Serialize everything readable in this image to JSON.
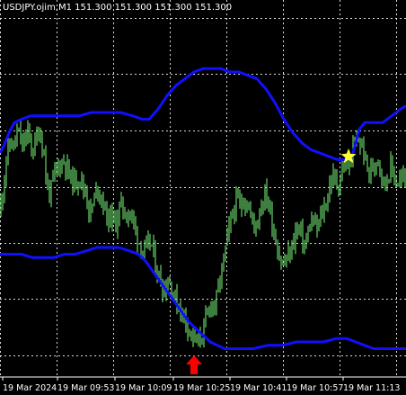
{
  "window": {
    "header": "USDJPY.ojim,M1  151.300 151.300 151.300 151.300"
  },
  "colors": {
    "background": "#000000",
    "grid": "#ffffff",
    "candles": "#7CFC7C",
    "bands": "#1010ff",
    "buy_arrow": "#ff0000",
    "star": "#ffff33",
    "text": "#ffffff"
  },
  "icons": {
    "buy_signal": "red-up-arrow-icon",
    "sell_signal": "yellow-star-icon"
  },
  "chart_data": {
    "type": "candlestick",
    "symbol": "USDJPY.ojim",
    "timeframe": "M1",
    "x_tick_labels": [
      "19 Mar 2024",
      "19 Mar 09:53",
      "19 Mar 10:09",
      "19 Mar 10:25",
      "19 Mar 10:41",
      "19 Mar 10:57",
      "19 Mar 11:13"
    ],
    "grid": true,
    "ylim": [
      0,
      100
    ],
    "upper_band": [
      [
        0,
        60
      ],
      [
        4,
        62
      ],
      [
        10,
        66
      ],
      [
        16,
        69
      ],
      [
        24,
        70
      ],
      [
        34,
        71
      ],
      [
        48,
        71
      ],
      [
        60,
        71
      ],
      [
        74,
        71
      ],
      [
        88,
        71
      ],
      [
        102,
        72
      ],
      [
        118,
        72
      ],
      [
        134,
        72
      ],
      [
        148,
        71
      ],
      [
        158,
        70
      ],
      [
        166,
        70
      ],
      [
        176,
        73
      ],
      [
        186,
        77
      ],
      [
        196,
        80
      ],
      [
        206,
        82
      ],
      [
        216,
        84
      ],
      [
        226,
        85
      ],
      [
        236,
        85
      ],
      [
        246,
        85
      ],
      [
        256,
        84
      ],
      [
        266,
        84
      ],
      [
        276,
        83
      ],
      [
        286,
        82
      ],
      [
        296,
        79
      ],
      [
        306,
        75
      ],
      [
        316,
        70
      ],
      [
        326,
        66
      ],
      [
        336,
        63
      ],
      [
        346,
        61
      ],
      [
        356,
        60
      ],
      [
        366,
        59
      ],
      [
        376,
        58
      ],
      [
        386,
        58
      ],
      [
        392,
        59
      ],
      [
        400,
        67
      ],
      [
        406,
        69
      ],
      [
        416,
        69
      ],
      [
        426,
        69
      ],
      [
        436,
        71
      ],
      [
        446,
        73
      ],
      [
        452,
        74
      ]
    ],
    "lower_band": [
      [
        0,
        30
      ],
      [
        12,
        30
      ],
      [
        24,
        30
      ],
      [
        36,
        29
      ],
      [
        48,
        29
      ],
      [
        60,
        29
      ],
      [
        72,
        30
      ],
      [
        84,
        30
      ],
      [
        96,
        31
      ],
      [
        108,
        32
      ],
      [
        120,
        32
      ],
      [
        132,
        32
      ],
      [
        144,
        31
      ],
      [
        154,
        30
      ],
      [
        162,
        28
      ],
      [
        170,
        25
      ],
      [
        178,
        22
      ],
      [
        186,
        19
      ],
      [
        194,
        16
      ],
      [
        202,
        13
      ],
      [
        210,
        10
      ],
      [
        218,
        8
      ],
      [
        226,
        6
      ],
      [
        234,
        4
      ],
      [
        242,
        3
      ],
      [
        250,
        2
      ],
      [
        258,
        2
      ],
      [
        270,
        2
      ],
      [
        282,
        2
      ],
      [
        298,
        3
      ],
      [
        314,
        3
      ],
      [
        330,
        4
      ],
      [
        346,
        4
      ],
      [
        360,
        4
      ],
      [
        374,
        5
      ],
      [
        386,
        5
      ],
      [
        396,
        4
      ],
      [
        406,
        3
      ],
      [
        416,
        2
      ],
      [
        426,
        2
      ],
      [
        438,
        2
      ],
      [
        452,
        2
      ]
    ],
    "price_path": [
      [
        0,
        42
      ],
      [
        4,
        52
      ],
      [
        8,
        60
      ],
      [
        12,
        63
      ],
      [
        16,
        62
      ],
      [
        20,
        67
      ],
      [
        24,
        62
      ],
      [
        28,
        64
      ],
      [
        32,
        66
      ],
      [
        36,
        60
      ],
      [
        40,
        64
      ],
      [
        44,
        67
      ],
      [
        48,
        62
      ],
      [
        52,
        50
      ],
      [
        56,
        48
      ],
      [
        60,
        53
      ],
      [
        64,
        56
      ],
      [
        68,
        57
      ],
      [
        72,
        58
      ],
      [
        76,
        54
      ],
      [
        80,
        52
      ],
      [
        84,
        51
      ],
      [
        88,
        54
      ],
      [
        92,
        50
      ],
      [
        96,
        48
      ],
      [
        100,
        42
      ],
      [
        104,
        45
      ],
      [
        108,
        50
      ],
      [
        112,
        48
      ],
      [
        116,
        44
      ],
      [
        120,
        40
      ],
      [
        124,
        42
      ],
      [
        128,
        38
      ],
      [
        132,
        43
      ],
      [
        136,
        45
      ],
      [
        140,
        41
      ],
      [
        144,
        43
      ],
      [
        148,
        40
      ],
      [
        152,
        36
      ],
      [
        156,
        33
      ],
      [
        160,
        30
      ],
      [
        164,
        32
      ],
      [
        168,
        34
      ],
      [
        172,
        28
      ],
      [
        176,
        24
      ],
      [
        180,
        21
      ],
      [
        184,
        20
      ],
      [
        188,
        23
      ],
      [
        192,
        19
      ],
      [
        196,
        16
      ],
      [
        200,
        14
      ],
      [
        204,
        12
      ],
      [
        208,
        10
      ],
      [
        212,
        7
      ],
      [
        216,
        5
      ],
      [
        220,
        3
      ],
      [
        224,
        6
      ],
      [
        228,
        9
      ],
      [
        232,
        13
      ],
      [
        236,
        16
      ],
      [
        240,
        15
      ],
      [
        244,
        21
      ],
      [
        248,
        27
      ],
      [
        252,
        33
      ],
      [
        256,
        39
      ],
      [
        260,
        43
      ],
      [
        264,
        46
      ],
      [
        268,
        44
      ],
      [
        272,
        47
      ],
      [
        276,
        44
      ],
      [
        280,
        41
      ],
      [
        284,
        38
      ],
      [
        288,
        42
      ],
      [
        292,
        46
      ],
      [
        296,
        48
      ],
      [
        300,
        44
      ],
      [
        304,
        38
      ],
      [
        308,
        33
      ],
      [
        312,
        28
      ],
      [
        316,
        27
      ],
      [
        320,
        29
      ],
      [
        324,
        31
      ],
      [
        328,
        36
      ],
      [
        332,
        38
      ],
      [
        336,
        35
      ],
      [
        340,
        32
      ],
      [
        344,
        38
      ],
      [
        348,
        40
      ],
      [
        352,
        37
      ],
      [
        356,
        40
      ],
      [
        360,
        43
      ],
      [
        364,
        46
      ],
      [
        368,
        52
      ],
      [
        372,
        53
      ],
      [
        376,
        50
      ],
      [
        380,
        54
      ],
      [
        384,
        57
      ],
      [
        388,
        56
      ],
      [
        392,
        60
      ],
      [
        396,
        63
      ],
      [
        400,
        64
      ],
      [
        404,
        61
      ],
      [
        408,
        56
      ],
      [
        412,
        54
      ],
      [
        416,
        56
      ],
      [
        420,
        60
      ],
      [
        424,
        55
      ],
      [
        428,
        50
      ],
      [
        432,
        54
      ],
      [
        436,
        56
      ],
      [
        440,
        52
      ],
      [
        444,
        51
      ],
      [
        448,
        53
      ],
      [
        452,
        52
      ]
    ],
    "buy_signal_x": 216,
    "sell_signal_x": 388
  }
}
